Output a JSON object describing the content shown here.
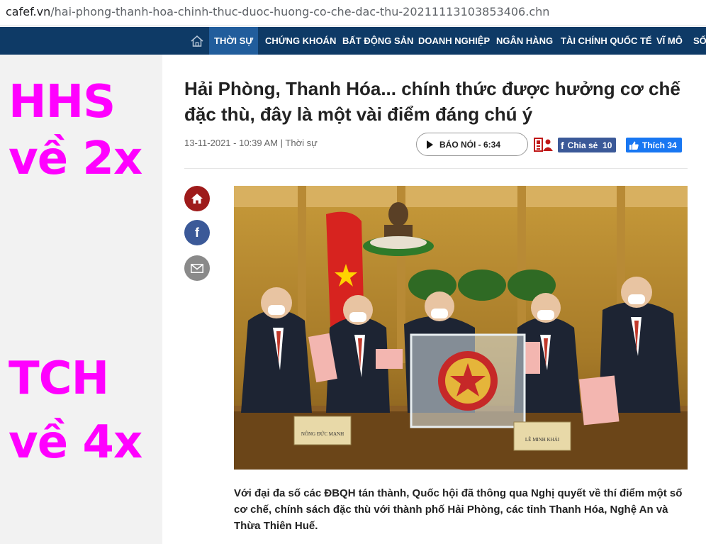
{
  "browser": {
    "url_host": "cafef.vn",
    "url_path": "/hai-phong-thanh-hoa-chinh-thuc-duoc-huong-co-che-dac-thu-20211113103853406.chn"
  },
  "nav": {
    "items": [
      {
        "label": "THỜI SỰ",
        "active": true
      },
      {
        "label": "CHỨNG KHOÁN"
      },
      {
        "label": "BẤT ĐỘNG SẢN"
      },
      {
        "label": "DOANH NGHIỆP"
      },
      {
        "label": "NGÂN HÀNG"
      },
      {
        "label": "TÀI CHÍNH QUỐC TẾ"
      },
      {
        "label": "VĨ MÔ"
      },
      {
        "label": "SỐ"
      }
    ]
  },
  "overlay": {
    "line1": "HHS",
    "line2": "về 2x",
    "line3": "TCH",
    "line4": "về 4x",
    "color": "#ff00ff"
  },
  "article": {
    "title": "Hải Phòng, Thanh Hóa... chính thức được hưởng cơ chế đặc thù, đây là một vài điểm đáng chú ý",
    "date": "13-11-2021 - 10:39 AM",
    "separator": "|",
    "category": "Thời sự",
    "listen_label": "BÁO NÓI - 6:34",
    "share_label": "Chia sẻ",
    "share_count": "10",
    "like_label": "Thích",
    "like_count": "34",
    "lead": "Với đại đa số các ĐBQH tán thành, Quốc hội đã thông qua Nghị quyết về thí điểm một số cơ chế, chính sách đặc thù với thành phố Hải Phòng, các tỉnh Thanh Hóa, Nghệ An và Thừa Thiên Huế.",
    "photo_nameplate_left": "NÔNG ĐỨC MẠNH",
    "photo_nameplate_right": "LÊ MINH KHẢI"
  },
  "colors": {
    "nav_bg": "#0e3a66",
    "nav_active": "#215d9c",
    "social_home": "#9e1b1b",
    "social_fb": "#3b5998",
    "social_mail": "#8a8a8a"
  }
}
